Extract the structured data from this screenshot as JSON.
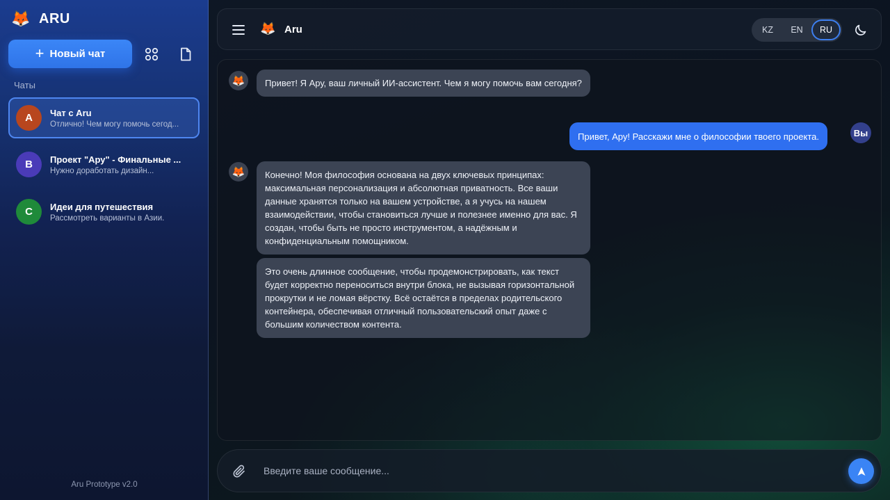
{
  "app": {
    "name": "ARU",
    "version": "Aru Prototype v2.0"
  },
  "sidebar": {
    "new_chat_label": "Новый чат",
    "section_label": "Чаты",
    "chats": [
      {
        "initial": "A",
        "title": "Чат с Aru",
        "preview": "Отлично! Чем могу помочь сегод...",
        "avatar_color": "#b8461e",
        "active": true
      },
      {
        "initial": "B",
        "title": "Проект \"Ару\" - Финальные ...",
        "preview": "Нужно доработать дизайн...",
        "avatar_color": "#4a3bb8",
        "active": false
      },
      {
        "initial": "C",
        "title": "Идеи для путешествия",
        "preview": "Рассмотреть варианты в Азии.",
        "avatar_color": "#1f8a3a",
        "active": false
      }
    ]
  },
  "header": {
    "title": "Aru",
    "languages": [
      "KZ",
      "EN",
      "RU"
    ],
    "active_language": "RU"
  },
  "messages": [
    {
      "role": "bot",
      "text": "Привет! Я Ару, ваш личный ИИ-ассистент. Чем я могу помочь вам сегодня?"
    },
    {
      "role": "user",
      "text": "Привет, Ару! Расскажи мне о философии твоего проекта.",
      "avatar_label": "Вы"
    },
    {
      "role": "bot",
      "text": "Конечно! Моя философия основана на двух ключевых принципах: максимальная персонализация и абсолютная приватность. Все ваши данные хранятся только на вашем устройстве, а я учусь на нашем взаимодействии, чтобы становиться лучше и полезнее именно для вас. Я создан, чтобы быть не просто инструментом, а надёжным и конфиденциальным помощником."
    },
    {
      "role": "bot",
      "text": "Это очень длинное сообщение, чтобы продемонстрировать, как текст будет корректно переноситься внутри блока, не вызывая горизонтальной прокрутки и не ломая вёрстку. Всё остаётся в пределах родительского контейнера, обеспечивая отличный пользовательский опыт даже с большим количеством контента."
    }
  ],
  "composer": {
    "placeholder": "Введите ваше сообщение..."
  },
  "colors": {
    "accent": "#2f6ff0",
    "bot_bubble": "#3c4454",
    "user_bubble": "#2f6ff0"
  },
  "icons": [
    "fox-logo-icon",
    "plus-icon",
    "grid-icon",
    "document-icon",
    "hamburger-menu-icon",
    "moon-icon",
    "paperclip-icon",
    "send-arrow-icon"
  ]
}
